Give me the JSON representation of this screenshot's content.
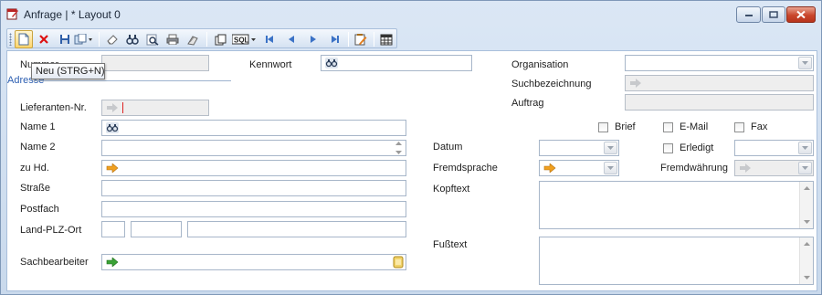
{
  "window": {
    "title": "Anfrage | * Layout 0",
    "icon": "document-edit-icon"
  },
  "toolbar": {
    "buttons": [
      {
        "name": "new-document-icon",
        "tooltip": "Neu (STRG+N)"
      },
      {
        "name": "delete-icon"
      },
      {
        "name": "save-icon"
      },
      {
        "name": "copy-dropdown-icon"
      },
      {
        "name": "eraser-icon"
      },
      {
        "name": "search-binoculars-icon"
      },
      {
        "name": "search-advanced-icon"
      },
      {
        "name": "print-icon"
      },
      {
        "name": "print-preview-icon"
      },
      {
        "name": "copy-pages-icon"
      },
      {
        "name": "sql-dropdown-icon"
      },
      {
        "name": "first-record-icon"
      },
      {
        "name": "previous-record-icon"
      },
      {
        "name": "next-record-icon"
      },
      {
        "name": "last-record-icon"
      },
      {
        "name": "edit-checklist-icon"
      },
      {
        "name": "grid-view-icon"
      }
    ],
    "sql_label": "SQL"
  },
  "tooltip": {
    "text": "Neu (STRG+N)"
  },
  "form": {
    "nummer_label": "Nummer",
    "adresse_label": "Adresse",
    "kennwort_label": "Kennwort",
    "organisation_label": "Organisation",
    "suchbezeichnung_label": "Suchbezeichnung",
    "auftrag_label": "Auftrag",
    "lieferanten_label": "Lieferanten-Nr.",
    "name1_label": "Name 1",
    "name2_label": "Name 2",
    "zuhd_label": "zu Hd.",
    "strasse_label": "Straße",
    "postfach_label": "Postfach",
    "land_label": "Land-PLZ-Ort",
    "sachbearbeiter_label": "Sachbearbeiter",
    "brief_label": "Brief",
    "email_label": "E-Mail",
    "fax_label": "Fax",
    "datum_label": "Datum",
    "erledigt_label": "Erledigt",
    "fremdsprache_label": "Fremdsprache",
    "fremdwaehrung_label": "Fremdwährung",
    "kopftext_label": "Kopftext",
    "fusstext_label": "Fußtext"
  },
  "colors": {
    "accent": "#3b72c6",
    "arrow_orange": "#f0a020",
    "arrow_green": "#3aa236",
    "close_red": "#c9462b"
  }
}
